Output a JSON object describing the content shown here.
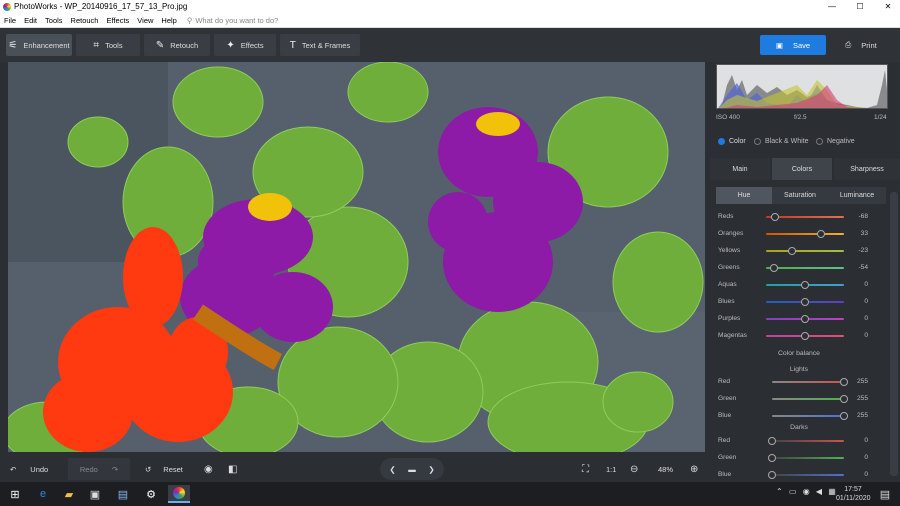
{
  "window": {
    "title": "PhotoWorks - WP_20140916_17_57_13_Pro.jpg",
    "controls": [
      "—",
      "☐",
      "✕"
    ]
  },
  "menu": {
    "items": [
      "File",
      "Edit",
      "Tools",
      "Retouch",
      "Effects",
      "View",
      "Help"
    ],
    "search_placeholder": "What do you want to do?"
  },
  "toolbar": {
    "tabs": [
      {
        "label": "Enhancement",
        "icon": "sliders-icon"
      },
      {
        "label": "Tools",
        "icon": "crop-icon"
      },
      {
        "label": "Retouch",
        "icon": "brush-icon"
      },
      {
        "label": "Effects",
        "icon": "wand-icon"
      },
      {
        "label": "Text & Frames",
        "icon": "text-icon"
      }
    ],
    "save_label": "Save",
    "print_label": "Print"
  },
  "histogram": {
    "iso": "ISO 400",
    "aperture": "f/2.5",
    "shutter": "1/24"
  },
  "color_mode": {
    "options": [
      "Color",
      "Black & White",
      "Negative"
    ],
    "selected": "Color"
  },
  "panel_tabs": {
    "items": [
      "Main",
      "Colors",
      "Sharpness"
    ],
    "active": "Colors"
  },
  "sub_tabs": {
    "items": [
      "Hue",
      "Saturation",
      "Luminance"
    ],
    "active": "Hue"
  },
  "hue_sliders": [
    {
      "label": "Reds",
      "value": "-68",
      "level": 0.12,
      "c1": "#c0392b",
      "c2": "#e07050"
    },
    {
      "label": "Oranges",
      "value": "33",
      "level": 0.7,
      "c1": "#d35400",
      "c2": "#f0b030"
    },
    {
      "label": "Yellows",
      "value": "-23",
      "level": 0.33,
      "c1": "#b0a020",
      "c2": "#a0c040"
    },
    {
      "label": "Greens",
      "value": "-54",
      "level": 0.1,
      "c1": "#4caf50",
      "c2": "#60c080"
    },
    {
      "label": "Aquas",
      "value": "0",
      "level": 0.5,
      "c1": "#20a0a0",
      "c2": "#40a0d0"
    },
    {
      "label": "Blues",
      "value": "0",
      "level": 0.5,
      "c1": "#2060c0",
      "c2": "#6040c0"
    },
    {
      "label": "Purples",
      "value": "0",
      "level": 0.5,
      "c1": "#8040c0",
      "c2": "#c040c0"
    },
    {
      "label": "Magentas",
      "value": "0",
      "level": 0.5,
      "c1": "#c040a0",
      "c2": "#e05070"
    }
  ],
  "color_balance": {
    "title": "Color balance",
    "lights_title": "Lights",
    "darks_title": "Darks",
    "lights": [
      {
        "label": "Red",
        "value": "255",
        "level": 1,
        "c": "#d05050"
      },
      {
        "label": "Green",
        "value": "255",
        "level": 1,
        "c": "#50b050"
      },
      {
        "label": "Blue",
        "value": "255",
        "level": 1,
        "c": "#5070d0"
      }
    ],
    "darks": [
      {
        "label": "Red",
        "value": "0",
        "level": 0,
        "c": "#d05050"
      },
      {
        "label": "Green",
        "value": "0",
        "level": 0,
        "c": "#50b050"
      },
      {
        "label": "Blue",
        "value": "0",
        "level": 0,
        "c": "#5070d0"
      }
    ]
  },
  "bottom": {
    "undo": "Undo",
    "redo": "Redo",
    "reset": "Reset",
    "ratio": "1:1",
    "zoom": "48%"
  },
  "taskbar": {
    "time": "17:57",
    "date": "01/11/2020"
  },
  "colors": {
    "accent": "#1e7be0",
    "bg": "#2b2e33"
  }
}
